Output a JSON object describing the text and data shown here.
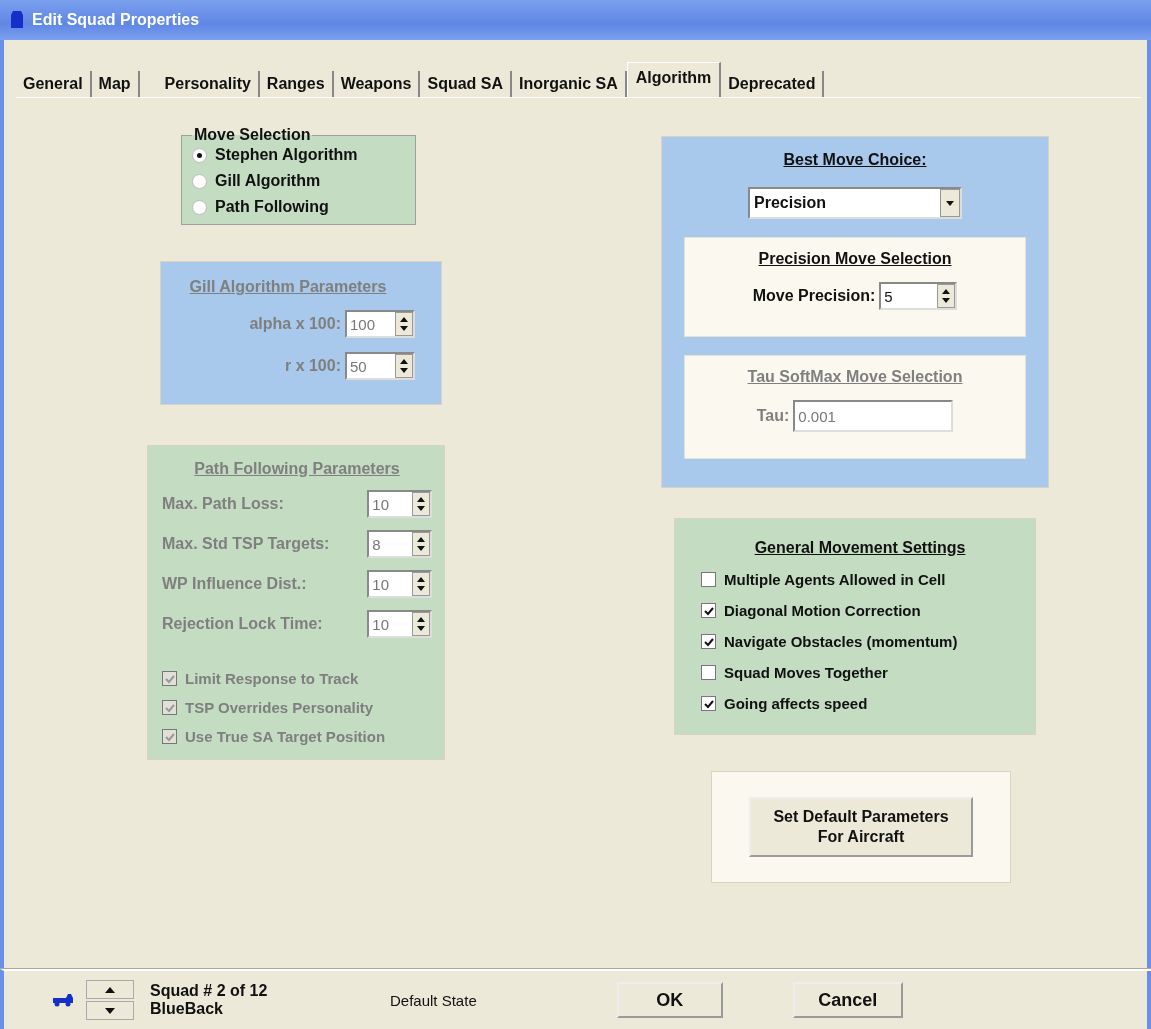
{
  "window": {
    "title": "Edit Squad Properties"
  },
  "tabs": [
    {
      "label": "General",
      "selected": false
    },
    {
      "label": "Map",
      "selected": false
    },
    {
      "label": "Personality",
      "selected": false
    },
    {
      "label": "Ranges",
      "selected": false
    },
    {
      "label": "Weapons",
      "selected": false
    },
    {
      "label": "Squad SA",
      "selected": false
    },
    {
      "label": "Inorganic SA",
      "selected": false
    },
    {
      "label": "Algorithm",
      "selected": true
    },
    {
      "label": "Deprecated",
      "selected": false
    }
  ],
  "move_selection": {
    "title": "Move Selection",
    "options": [
      {
        "label": "Stephen Algorithm",
        "selected": true
      },
      {
        "label": "Gill Algorithm",
        "selected": false
      },
      {
        "label": "Path Following",
        "selected": false
      }
    ]
  },
  "gill_parameters": {
    "title": "Gill Algorithm Parameters",
    "disabled": true,
    "fields": [
      {
        "label": "alpha x 100:",
        "value": "100"
      },
      {
        "label": "r x 100:",
        "value": "50"
      }
    ]
  },
  "path_following": {
    "title": "Path Following Parameters",
    "disabled": true,
    "fields": [
      {
        "label": "Max. Path Loss:",
        "value": "10"
      },
      {
        "label": "Max. Std TSP Targets:",
        "value": "8"
      },
      {
        "label": "WP Influence Dist.:",
        "value": "10"
      },
      {
        "label": "Rejection Lock Time:",
        "value": "10"
      }
    ],
    "checkboxes": [
      {
        "label": "Limit Response to Track",
        "checked": true
      },
      {
        "label": "TSP Overrides Personality",
        "checked": true
      },
      {
        "label": "Use True SA Target Position",
        "checked": true
      }
    ]
  },
  "best_move": {
    "title": "Best Move Choice:",
    "choice": "Precision",
    "precision": {
      "title": "Precision Move Selection",
      "disabled": false,
      "label": "Move Precision:",
      "value": "5"
    },
    "tau": {
      "title": "Tau SoftMax Move Selection",
      "disabled": true,
      "label": "Tau:",
      "value": "0.001"
    }
  },
  "general_movement": {
    "title": "General Movement Settings",
    "checkboxes": [
      {
        "label": "Multiple Agents Allowed in Cell",
        "checked": false
      },
      {
        "label": "Diagonal Motion Correction",
        "checked": true
      },
      {
        "label": "Navigate Obstacles (momentum)",
        "checked": true
      },
      {
        "label": "Squad Moves Together",
        "checked": false
      },
      {
        "label": "Going affects speed",
        "checked": true
      }
    ]
  },
  "default_button": {
    "label": "Set Default Parameters For Aircraft"
  },
  "status_bar": {
    "squad": "Squad # 2 of 12",
    "name": "BlueBack",
    "state": "Default State",
    "buttons": [
      "OK",
      "Cancel"
    ]
  }
}
